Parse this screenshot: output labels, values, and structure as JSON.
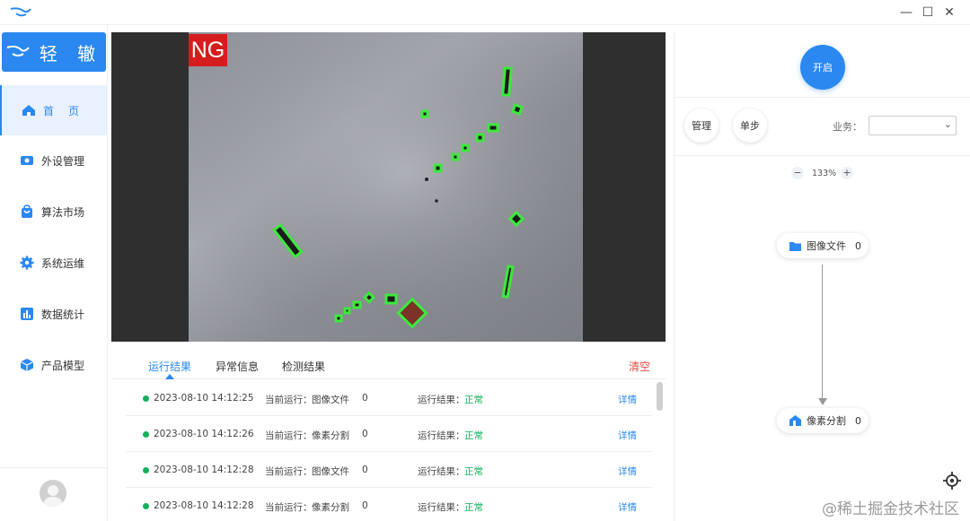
{
  "window": {
    "minimize": "—",
    "maximize": "☐",
    "close": "✕"
  },
  "sidebar": {
    "brand": "轻 辙",
    "items": [
      {
        "label": "首　页",
        "icon": "home-icon",
        "active": true
      },
      {
        "label": "外设管理",
        "icon": "camera-icon"
      },
      {
        "label": "算法市场",
        "icon": "shopping-bag-icon"
      },
      {
        "label": "系统运维",
        "icon": "gear-icon"
      },
      {
        "label": "数据统计",
        "icon": "bar-chart-icon"
      },
      {
        "label": "产品模型",
        "icon": "cube-icon"
      }
    ]
  },
  "viewer": {
    "badge": "NG"
  },
  "tabs": {
    "items": [
      "运行结果",
      "异常信息",
      "检测结果"
    ],
    "active": 0,
    "clear": "清空"
  },
  "results": [
    {
      "time": "2023-08-10 14:12:25",
      "run_label": "当前运行：",
      "step": "图像文件",
      "count": "0",
      "result_label": "运行结果：",
      "result": "正常",
      "detail": "详情"
    },
    {
      "time": "2023-08-10 14:12:26",
      "run_label": "当前运行：",
      "step": "像素分割",
      "count": "0",
      "result_label": "运行结果：",
      "result": "正常",
      "detail": "详情"
    },
    {
      "time": "2023-08-10 14:12:28",
      "run_label": "当前运行：",
      "step": "图像文件",
      "count": "0",
      "result_label": "运行结果：",
      "result": "正常",
      "detail": "详情"
    },
    {
      "time": "2023-08-10 14:12:28",
      "run_label": "当前运行：",
      "step": "像素分割",
      "count": "0",
      "result_label": "运行结果：",
      "result": "正常",
      "detail": "详情"
    }
  ],
  "panel": {
    "start": "开启",
    "manage": "管理",
    "step": "单步",
    "business_label": "业务：",
    "business_value": "",
    "zoom_out": "−",
    "zoom_in": "+",
    "zoom": "133%",
    "nodes": [
      {
        "label": "图像文件",
        "count": "0",
        "icon": "folder-icon"
      },
      {
        "label": "像素分割",
        "count": "0",
        "icon": "segment-icon"
      }
    ]
  },
  "watermark": "@稀土掘金技术社区",
  "colors": {
    "accent": "#2b88f0",
    "ok": "#16b05c",
    "danger": "#e54d42",
    "ng": "#d61d1d"
  }
}
